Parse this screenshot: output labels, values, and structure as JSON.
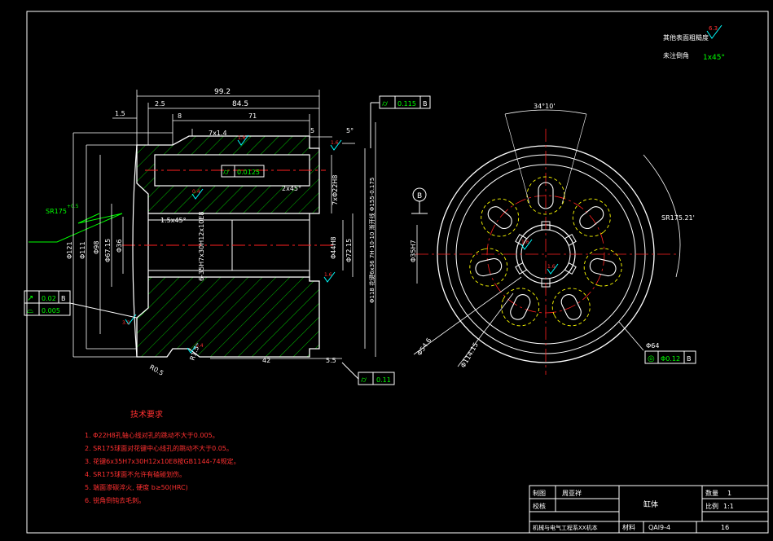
{
  "colors": {
    "background": "#000000",
    "outline": "#ffffff",
    "hatch": "#00cc00",
    "dimension": "#ffffff",
    "center": "#ff2020",
    "roughness": "#00ffff",
    "note": "#ff3030",
    "yellow": "#ffff00",
    "blue": "#3399ff"
  },
  "top_notes": {
    "roughness_label": "其他表面粗糙度",
    "roughness_value": "6.3",
    "chamfer_label": "未注倒角",
    "chamfer_value": "1x45°"
  },
  "section_view": {
    "dim_total": "99.2",
    "dim_2_5": "2.5",
    "dim_84_5": "84.5",
    "dim_1_5": "1.5",
    "dim_8": "8",
    "dim_71": "71",
    "dim_5": "5",
    "dim_5deg": "5°",
    "dim_7x1_4": "7x1.4",
    "dim_2x45": "2x45°",
    "dim_1_5x45": "1.5x45°",
    "dim_42": "42",
    "dim_5_5": "5.5",
    "dim_r1_5": "R1.5",
    "dim_r0_5": "R0.5",
    "sr": "SR175",
    "sr_tol": "+0.5",
    "dia_121": "Φ121",
    "dia_111": "Φ111",
    "dia_98": "Φ98",
    "dia_67": "Φ67.15",
    "dia_36": "Φ36",
    "dia_44": "Φ44H8",
    "dia_72": "Φ72.15",
    "dia_7x22": "7xΦ22H8",
    "spline": "6-35H7x30H12x10E8",
    "thread_callout": "Φ118 花键6x36 7H-10-10 渐开线 Φ155-0.175",
    "ra_1": "1.6",
    "ra_2": "1.6",
    "ra_3": "0.4",
    "ra_4": "1.6",
    "ra_5": "3.2",
    "ra_6": "1.6",
    "ra_7": "0.4",
    "fcf_top_sym": "⌭",
    "fcf_top_val": "0.115",
    "fcf_top_datum": "B",
    "fcf_mid_sym": "⌭",
    "fcf_mid_val": "0.0125",
    "fcf_left1_sym": "↗",
    "fcf_left1_val": "0.02",
    "fcf_left1_datum": "B",
    "fcf_left2_sym": "⌓",
    "fcf_left2_val": "0.005",
    "fcf_bottom_sym": "⌭",
    "fcf_bottom_val": "0.11"
  },
  "end_view": {
    "datum": "B",
    "angle_34": "34°10'",
    "sr_label": "SR175.21'",
    "dia_35": "Φ35H7",
    "dia_54": "Φ54.6",
    "dia_114": "Φ114.15",
    "dia_64": "Φ64",
    "fcf_sym": "◎",
    "fcf_val": "Φ0.12",
    "fcf_datum": "B",
    "ra_a": "1.6",
    "ra_b": "1.6"
  },
  "requirements": {
    "title": "技术要求",
    "items": [
      "1. Φ22H8孔轴心线对孔的跳动不大于0.005。",
      "2. SR175球面对花键中心线孔的跳动不大于0.05。",
      "3. 花键6x35H7x30H12x10E8按GB1144-74规定。",
      "4. SR175球面不允许有磕碰划伤。",
      "5. 端面渗碳淬火, 硬度 b≥50(HRC)",
      "6. 锐角倒钝去毛刺。"
    ]
  },
  "title_block": {
    "drawn_label": "制图",
    "drawn_name": "周亚祥",
    "checked_label": "校核",
    "part_name": "缸体",
    "qty_label": "数量",
    "qty_value": "1",
    "scale_label": "比例",
    "scale_value": "1:1",
    "school": "机械与电气工程系XX机本",
    "material_label": "材料",
    "material_value": "QAl9-4",
    "sheet": "16"
  }
}
